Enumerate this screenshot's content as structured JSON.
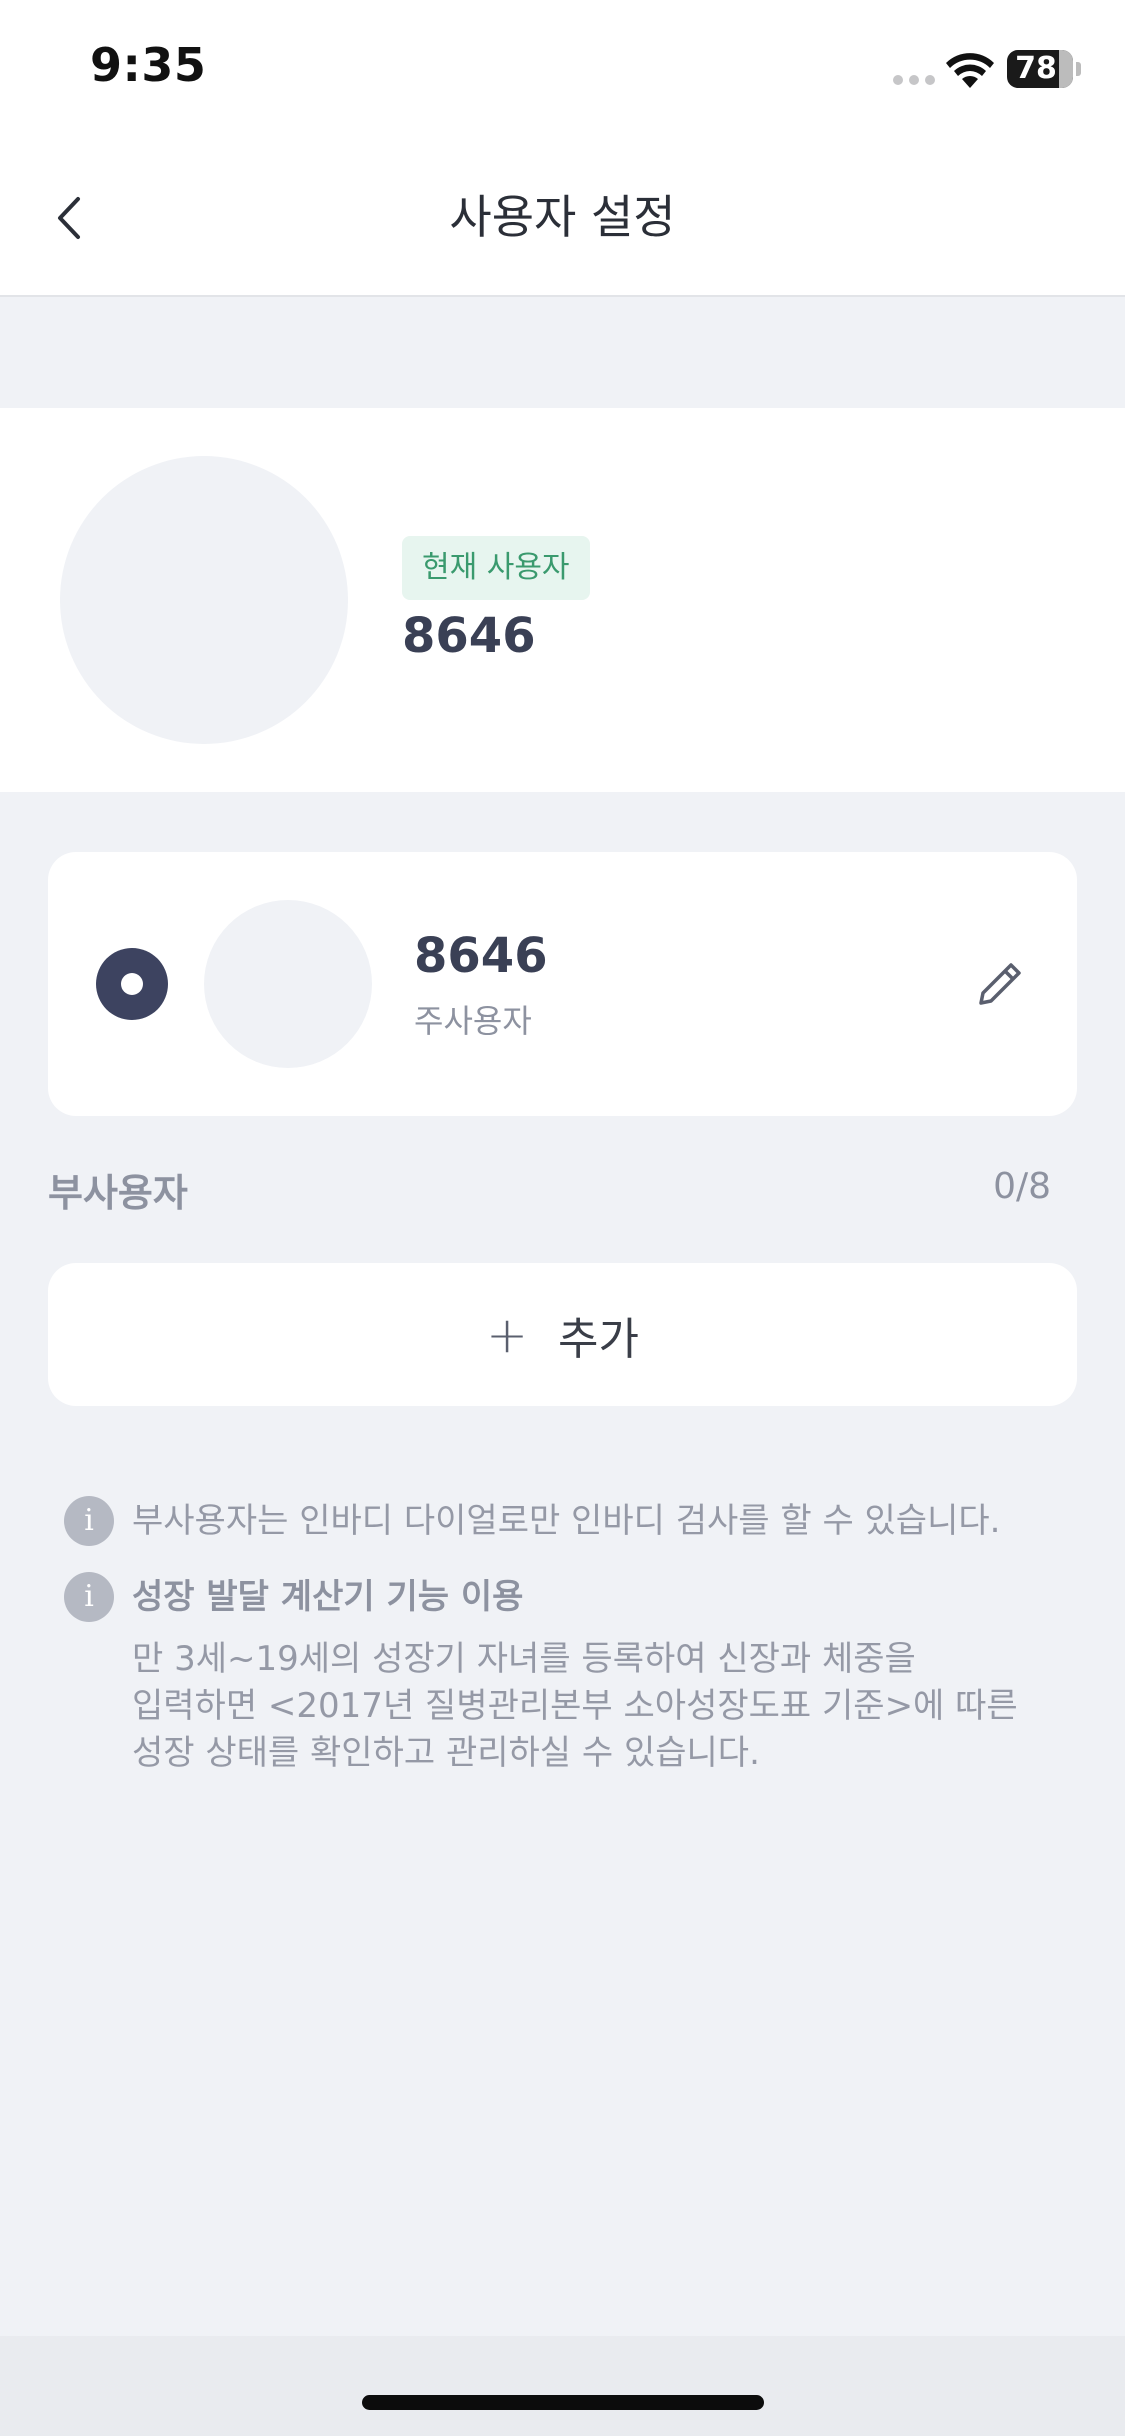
{
  "status_bar": {
    "time": "9:35",
    "battery_percent": "78"
  },
  "nav": {
    "title": "사용자 설정",
    "back_icon": "chevron-left-icon"
  },
  "profile": {
    "badge": "현재 사용자",
    "name": "8646"
  },
  "main_user": {
    "name": "8646",
    "role": "주사용자",
    "selected": true,
    "edit_icon": "pencil-icon"
  },
  "sub_users": {
    "label": "부사용자",
    "count": "0/8"
  },
  "add_button": {
    "plus": "+",
    "label": "추가"
  },
  "notes": {
    "note1": "부사용자는 인바디 다이얼로만 인바디 검사를 할 수 있습니다.",
    "note2_title": "성장 발달 계산기 기능 이용",
    "note2_line1": "만 3세~19세의 성장기 자녀를 등록하여 신장과 체중을",
    "note2_line2": "입력하면 <2017년 질병관리본부 소아성장도표 기준>에 따른",
    "note2_line3": "성장 상태를 확인하고 관리하실 수 있습니다.",
    "icon_glyph": "i"
  }
}
